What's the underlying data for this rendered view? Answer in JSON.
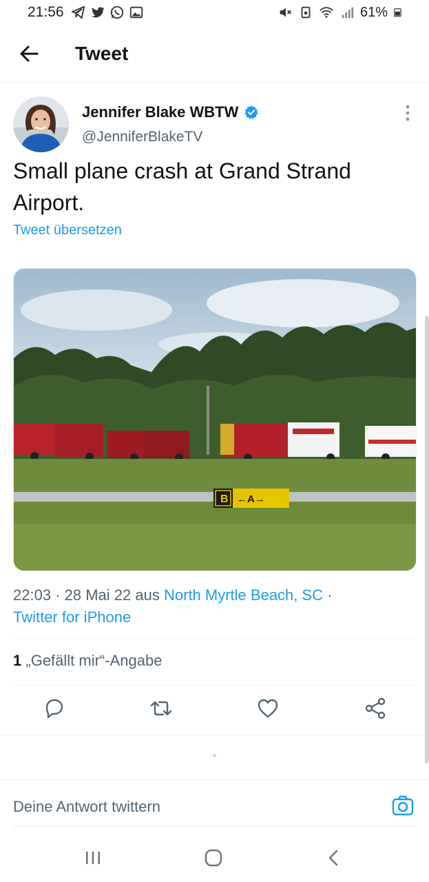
{
  "status_bar": {
    "time": "21:56",
    "left_icons": [
      "telegram-icon",
      "twitter-icon",
      "whatsapp-icon",
      "gallery-icon"
    ],
    "right_icons": [
      "mute-icon",
      "save-icon",
      "wifi-icon",
      "signal-icon"
    ],
    "battery": "61%"
  },
  "header": {
    "title": "Tweet"
  },
  "tweet": {
    "author_name": "Jennifer Blake WBTW",
    "handle": "@JenniferBlakeTV",
    "verified": true,
    "text": "Small plane crash at Grand Strand Airport.",
    "translate_label": "Tweet übersetzen",
    "photo_sign_text": "B ←A→",
    "meta": {
      "time": "22:03",
      "date": "28 Mai 22",
      "aus": "aus",
      "location": "North Myrtle Beach, SC",
      "source": "Twitter for iPhone"
    },
    "likes": {
      "count": "1",
      "label": "„Gefällt mir“-Angabe"
    },
    "actions": [
      "reply-icon",
      "retweet-icon",
      "like-icon",
      "share-icon"
    ]
  },
  "reply": {
    "placeholder": "Deine Antwort twittern"
  },
  "colors": {
    "accent": "#1d9bf0",
    "text": "#0f1419",
    "muted": "#536471"
  }
}
